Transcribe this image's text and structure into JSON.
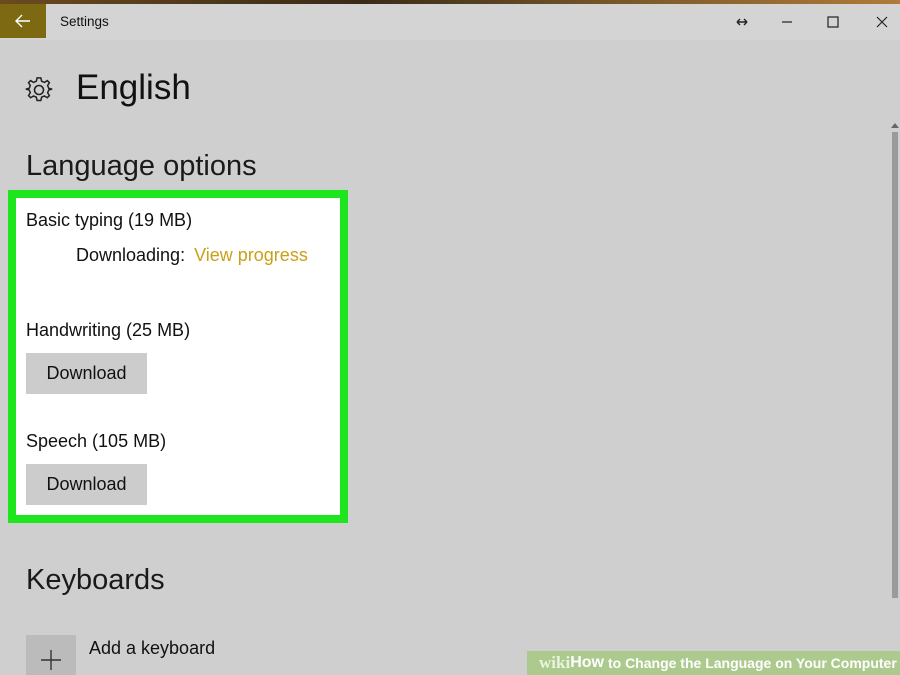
{
  "window": {
    "title": "Settings",
    "back_icon": "arrow-left-icon",
    "controls": [
      "resize-icon",
      "minimize-icon",
      "maximize-icon",
      "close-icon"
    ]
  },
  "header": {
    "icon": "gear-icon",
    "title": "English"
  },
  "language_options": {
    "heading": "Language options",
    "highlight_color": "#1ee61e",
    "items": [
      {
        "label": "Basic typing (19 MB)",
        "status": "Downloading:",
        "link": "View progress"
      },
      {
        "label": "Handwriting (25 MB)",
        "button": "Download"
      },
      {
        "label": "Speech (105 MB)",
        "button": "Download"
      }
    ]
  },
  "keyboards": {
    "heading": "Keyboards",
    "add_label": "Add a keyboard",
    "add_icon": "plus-icon"
  },
  "colors": {
    "accent": "#7d6912",
    "link": "#c9a018",
    "background": "#cfcfcf"
  },
  "watermark": {
    "wiki": "wiki",
    "how": "How",
    "text": "to Change the Language on Your Computer"
  }
}
